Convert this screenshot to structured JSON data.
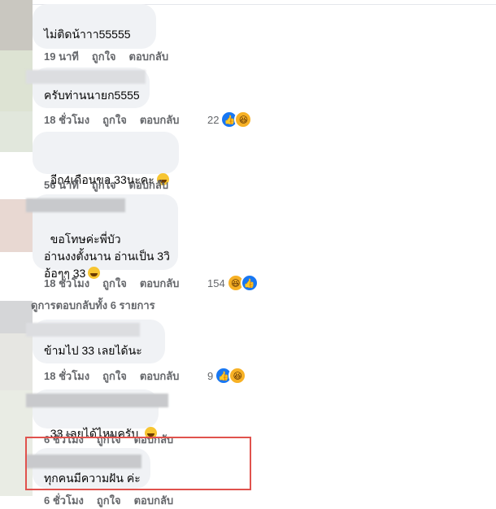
{
  "actions": {
    "like": "ถูกใจ",
    "reply": "ตอบกลับ"
  },
  "comments": [
    {
      "text": "ไม่ติดน้าาา55555",
      "time": "19 นาที"
    },
    {
      "text": "ครับท่านนายก5555",
      "time": "18 ชั่วโมง",
      "reactions": "22"
    },
    {
      "text": "อีก4เดือนขอ 33นะคะ",
      "time": "56 นาที"
    },
    {
      "text": "ขอโทษค่ะพี่บัว\nอ่านงงตั้งนาน อ่านเป็น 3วิ\nอ้อๆๆ 33",
      "time": "18 ชั่วโมง",
      "reactions": "154"
    },
    {
      "text": "ข้ามไป 33 เลยได้นะ",
      "time": "18 ชั่วโมง",
      "reactions": "9"
    },
    {
      "text": "33 เลยได้ไหมครับ",
      "time": "6 ชั่วโมง"
    },
    {
      "text": "ทุกคนมีความฝัน ค่ะ",
      "time": "6 ชั่วโมง"
    }
  ],
  "view_replies": "ดูการตอบกลับทั้ง 6 รายการ",
  "colors": {
    "highlight": "#e0524d",
    "bubble": "#f0f2f5",
    "meta": "#65676b"
  }
}
